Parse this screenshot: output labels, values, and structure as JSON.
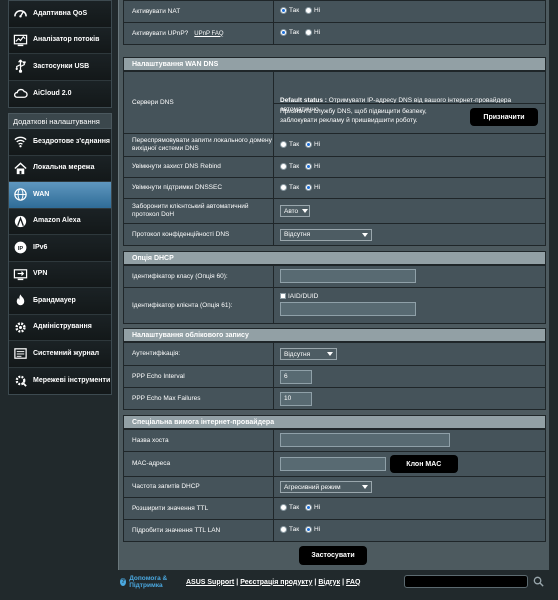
{
  "sidebar": {
    "general_items": [
      {
        "label": "Адаптивна QoS",
        "icon": "qos-gauge-icon"
      },
      {
        "label": "Аналізатор потоків",
        "icon": "traffic-analyzer-icon"
      },
      {
        "label": "Застосунки USB",
        "icon": "usb-apps-icon"
      },
      {
        "label": "AiCloud 2.0",
        "icon": "cloud-icon"
      }
    ],
    "advanced_header": "Додаткові налаштування",
    "advanced_items": [
      {
        "label": "Бездротове з'єднання",
        "icon": "wireless-icon"
      },
      {
        "label": "Локальна мережа",
        "icon": "home-lan-icon"
      },
      {
        "label": "WAN",
        "icon": "globe-wan-icon",
        "active": true
      },
      {
        "label": "Amazon Alexa",
        "icon": "alexa-icon"
      },
      {
        "label": "IPv6",
        "icon": "ipv6-icon"
      },
      {
        "label": "VPN",
        "icon": "vpn-icon"
      },
      {
        "label": "Брандмауер",
        "icon": "firewall-icon"
      },
      {
        "label": "Адміністрування",
        "icon": "admin-gear-icon"
      },
      {
        "label": "Системний журнал",
        "icon": "system-log-icon"
      },
      {
        "label": "Мережеві інструменти",
        "icon": "network-tools-icon"
      }
    ]
  },
  "top_rows": {
    "nat": {
      "label": "Активувати NAT",
      "yes": "Так",
      "no": "Ні",
      "selected": "yes"
    },
    "upnp": {
      "label": "Активувати UPnP?",
      "link": "UPnP  FAQ",
      "yes": "Так",
      "no": "Ні",
      "selected": "yes"
    }
  },
  "dns_section": {
    "title": "Налаштування WAN DNS",
    "dns_server_label": "Сервери DNS",
    "default_status_key": "Default status :",
    "default_status_text": "Отримувати IP-адресу DNS від вашого інтернет-провайдера автоматично.",
    "hint": "Призначте службу DNS, щоб підвищити безпеку, заблокувати рекламу й пришвидшити роботу.",
    "assign_button": "Призначити",
    "forward_local": {
      "label": "Переспрямовувати запити локального домену вихідної системи DNS",
      "yes": "Так",
      "no": "Ні",
      "selected": "no"
    },
    "rebind": {
      "label": "Увімкнути захист DNS Rebind",
      "yes": "Так",
      "no": "Ні",
      "selected": "no"
    },
    "dnssec": {
      "label": "Увімкнути підтримки DNSSEC",
      "yes": "Так",
      "no": "Ні",
      "selected": "no"
    },
    "doh": {
      "label": "Заборонити клієнтський автоматичний протокол DoH",
      "value": "Авто"
    },
    "privacy": {
      "label": "Протокол конфіденційності DNS",
      "value": "Відсутня"
    }
  },
  "dhcp_section": {
    "title": "Опція DHCP",
    "class_id_label": "Ідентифікатор класу (Опція 60):",
    "class_id_value": "",
    "client_id_label": "Ідентифікатор клієнта (Опція 61):",
    "iaid_label": "IAID/DUID",
    "client_id_value": ""
  },
  "account_section": {
    "title": "Налаштування облікового запису",
    "auth_label": "Аутентифікація:",
    "auth_value": "Відсутня",
    "echo_interval_label": "PPP Echo Interval",
    "echo_interval_value": "6",
    "echo_failures_label": "PPP Echo Max Failures",
    "echo_failures_value": "10"
  },
  "isp_section": {
    "title": "Спеціальна вимога інтернет-провайдера",
    "hostname_label": "Назва хоста",
    "hostname_value": "",
    "mac_label": "MAC-адреса",
    "mac_value": "",
    "clone_mac_button": "Клон MAC",
    "dhcp_freq_label": "Частота запитів DHCP",
    "dhcp_freq_value": "Агресивний режим",
    "extend_ttl": {
      "label": "Розширити значення TTL",
      "yes": "Так",
      "no": "Ні",
      "selected": "no"
    },
    "spoof_ttl": {
      "label": "Підробити значення TTL LAN",
      "yes": "Так",
      "no": "Ні",
      "selected": "no"
    }
  },
  "apply_button": "Застосувати",
  "footer": {
    "help": "Допомога & Підтримка",
    "links": [
      "ASUS Support",
      "Реєстрація продукту",
      "Відгук",
      "FAQ"
    ],
    "search_placeholder": ""
  },
  "colors": {
    "background": "#21292c",
    "panel": "#45535a",
    "section_header": "#92a0a5",
    "active_nav": "#3f7fab",
    "radio_selected": "#1d6fd8",
    "help_link": "#4aa8e0"
  }
}
